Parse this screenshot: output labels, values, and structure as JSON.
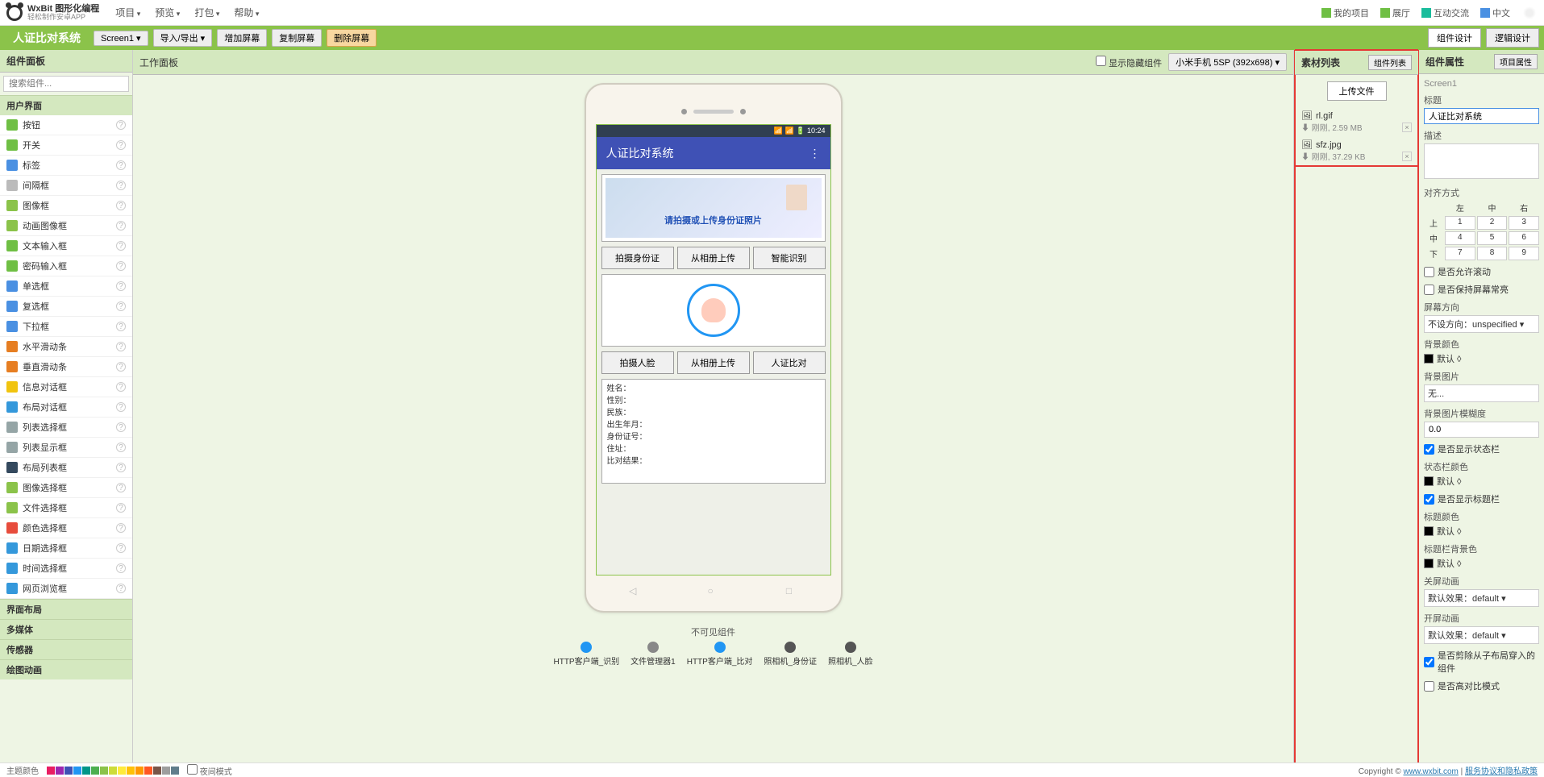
{
  "brand": {
    "title": "WxBit 图形化编程",
    "sub": "轻松制作安卓APP"
  },
  "topmenu": [
    "项目",
    "预览",
    "打包",
    "帮助"
  ],
  "topright": {
    "my_projects": "我的项目",
    "gallery": "展厅",
    "community": "互动交流",
    "lang": "中文"
  },
  "project_name": "人证比对系统",
  "greenbar": {
    "screen": "Screen1 ▾",
    "io": "导入/导出 ▾",
    "add": "增加屏幕",
    "copy": "复制屏幕",
    "del": "删除屏幕",
    "design": "组件设计",
    "logic": "逻辑设计"
  },
  "palette": {
    "header": "组件面板",
    "search_ph": "搜索组件...",
    "group_ui": "用户界面",
    "items": [
      {
        "label": "按钮",
        "ico": "#6fbf44"
      },
      {
        "label": "开关",
        "ico": "#6fbf44"
      },
      {
        "label": "标签",
        "ico": "#4a90e2"
      },
      {
        "label": "间隔框",
        "ico": "#bbb"
      },
      {
        "label": "图像框",
        "ico": "#8bc34a"
      },
      {
        "label": "动画图像框",
        "ico": "#8bc34a"
      },
      {
        "label": "文本输入框",
        "ico": "#6fbf44"
      },
      {
        "label": "密码输入框",
        "ico": "#6fbf44"
      },
      {
        "label": "单选框",
        "ico": "#4a90e2"
      },
      {
        "label": "复选框",
        "ico": "#4a90e2"
      },
      {
        "label": "下拉框",
        "ico": "#4a90e2"
      },
      {
        "label": "水平滑动条",
        "ico": "#e67e22"
      },
      {
        "label": "垂直滑动条",
        "ico": "#e67e22"
      },
      {
        "label": "信息对话框",
        "ico": "#f1c40f"
      },
      {
        "label": "布局对话框",
        "ico": "#3498db"
      },
      {
        "label": "列表选择框",
        "ico": "#95a5a6"
      },
      {
        "label": "列表显示框",
        "ico": "#95a5a6"
      },
      {
        "label": "布局列表框",
        "ico": "#34495e"
      },
      {
        "label": "图像选择框",
        "ico": "#8bc34a"
      },
      {
        "label": "文件选择框",
        "ico": "#8bc34a"
      },
      {
        "label": "颜色选择框",
        "ico": "#e74c3c"
      },
      {
        "label": "日期选择框",
        "ico": "#3498db"
      },
      {
        "label": "时间选择框",
        "ico": "#3498db"
      },
      {
        "label": "网页浏览框",
        "ico": "#3498db"
      }
    ],
    "group_layout": "界面布局",
    "group_media": "多媒体",
    "group_sensor": "传感器",
    "group_draw": "绘图动画"
  },
  "work": {
    "header": "工作面板",
    "show_hidden": "显示隐藏组件",
    "device": "小米手机 5SP (392x698) ▾",
    "statusbar": "📶 📶 🔋 10:24",
    "app_title": "人证比对系统",
    "id_overlay": "请拍摄或上传身份证照片",
    "row1": [
      "拍摄身份证",
      "从相册上传",
      "智能识别"
    ],
    "row2": [
      "拍摄人脸",
      "从相册上传",
      "人证比对"
    ],
    "result_lines": [
      "姓名：",
      "性别：",
      "民族：",
      "出生年月：",
      "身份证号：",
      "住址：",
      "比对结果："
    ],
    "invisible_label": "不可见组件",
    "inv_items": [
      {
        "label": "HTTP客户端_识别",
        "color": "#2196f3"
      },
      {
        "label": "文件管理器1",
        "color": "#888"
      },
      {
        "label": "HTTP客户端_比对",
        "color": "#2196f3"
      },
      {
        "label": "照相机_身份证",
        "color": "#555"
      },
      {
        "label": "照相机_人脸",
        "color": "#555"
      }
    ]
  },
  "assets": {
    "header": "素材列表",
    "header_btn": "组件列表",
    "upload": "上传文件",
    "files": [
      {
        "name": "rl.gif",
        "meta": "刚刚, 2.59 MB"
      },
      {
        "name": "sfz.jpg",
        "meta": "刚刚, 37.29 KB"
      }
    ]
  },
  "props": {
    "header": "组件属性",
    "header_btn": "项目属性",
    "selected": "Screen1",
    "title_label": "标题",
    "title_value": "人证比对系统",
    "desc_label": "描述",
    "align_label": "对齐方式",
    "align_cols": [
      "左",
      "中",
      "右"
    ],
    "align_rows": [
      "上",
      "中",
      "下"
    ],
    "align_cells": [
      [
        "1",
        "2",
        "3"
      ],
      [
        "4",
        "5",
        "6"
      ],
      [
        "7",
        "8",
        "9"
      ]
    ],
    "chk_scroll": "是否允许滚动",
    "chk_keep": "是否保持屏幕常亮",
    "orient_label": "屏幕方向",
    "orient_value": "不设方向：unspecified ▾",
    "bgcolor_label": "背景颜色",
    "default_val": "默认 ◊",
    "bgimg_label": "背景图片",
    "bgimg_value": "无...",
    "bgblur_label": "背景图片模糊度",
    "bgblur_value": "0.0",
    "chk_status": "是否显示状态栏",
    "statuscolor_label": "状态栏颜色",
    "chk_titlebar": "是否显示标题栏",
    "titlecolor_label": "标题颜色",
    "titlebg_label": "标题栏背景色",
    "close_anim_label": "关屏动画",
    "anim_value": "默认效果：default ▾",
    "open_anim_label": "开屏动画",
    "chk_clip": "是否剪除从子布局穿入的组件",
    "chk_contrast": "是否高对比模式"
  },
  "footer": {
    "theme_label": "主题颜色",
    "dark_label": "夜间模式",
    "copyright": "Copyright © ",
    "link1": "www.wxbit.com",
    "sep": " | ",
    "link2": "服务协议和隐私政策"
  }
}
